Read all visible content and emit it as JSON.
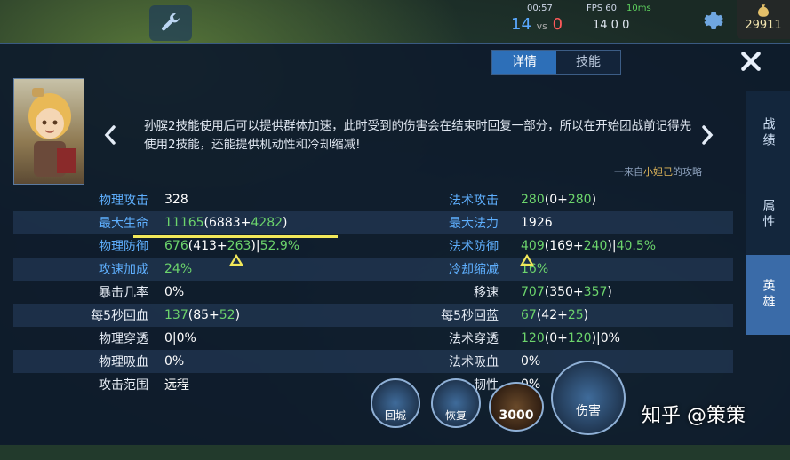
{
  "hud": {
    "clock": "00:57",
    "fps": "FPS 60",
    "ms": "10ms",
    "kills_blue": "14",
    "vs": "vs",
    "kills_red": "0",
    "kda": "14  0  0",
    "gold": "29911"
  },
  "tabs": [
    {
      "label": "详情",
      "active": true
    },
    {
      "label": "技能",
      "active": false
    }
  ],
  "tip": {
    "text": "孙膑2技能使用后可以提供群体加速，此时受到的伤害会在结束时回复一部分，所以在开始团战前记得先使用2技能，还能提供机动性和冷却缩减!",
    "credit_prefix": "一来自",
    "credit_author": "小妲己",
    "credit_suffix": "的攻略"
  },
  "side_tabs": [
    "战绩",
    "属性",
    "英雄"
  ],
  "stats": [
    {
      "l1": "物理攻击",
      "v1": "328",
      "l2": "法术攻击",
      "v2": "280(0+280)",
      "l1_blue": true,
      "l2_blue": true
    },
    {
      "l1": "最大生命",
      "v1": "11165(6883+4282)",
      "l2": "最大法力",
      "v2": "1926",
      "l1_blue": true,
      "l2_blue": true
    },
    {
      "l1": "物理防御",
      "v1": "676(413+263)|52.9%",
      "l2": "法术防御",
      "v2": "409(169+240)|40.5%",
      "l1_blue": true,
      "l2_blue": true
    },
    {
      "l1": "攻速加成",
      "v1": "24%",
      "l2": "冷却缩减",
      "v2": "16%",
      "l1_blue": true,
      "l2_blue": true
    },
    {
      "l1": "暴击几率",
      "v1": "0%",
      "l2": "移速",
      "v2": "707(350+357)",
      "l1_blue": false,
      "l2_blue": false
    },
    {
      "l1": "每5秒回血",
      "v1": "137(85+52)",
      "l2": "每5秒回蓝",
      "v2": "67(42+25)",
      "l1_blue": false,
      "l2_blue": false
    },
    {
      "l1": "物理穿透",
      "v1": "0|0%",
      "l2": "法术穿透",
      "v2": "120(0+120)|0%",
      "l1_blue": false,
      "l2_blue": false
    },
    {
      "l1": "物理吸血",
      "v1": "0%",
      "l2": "法术吸血",
      "v2": "0%",
      "l1_blue": false,
      "l2_blue": false
    },
    {
      "l1": "攻击范围",
      "v1": "远程",
      "l2": "韧性",
      "v2": "0%",
      "l1_blue": false,
      "l2_blue": false
    }
  ],
  "skills": {
    "recall": "回城",
    "heal": "恢复",
    "cost": "3000",
    "damage": "伤害"
  },
  "watermark": "知乎 @策策",
  "colors": {
    "accent": "#2d6fb8",
    "green": "#6cd46c",
    "blue_label": "#5fb0ff",
    "highlight": "#f2e85a"
  }
}
